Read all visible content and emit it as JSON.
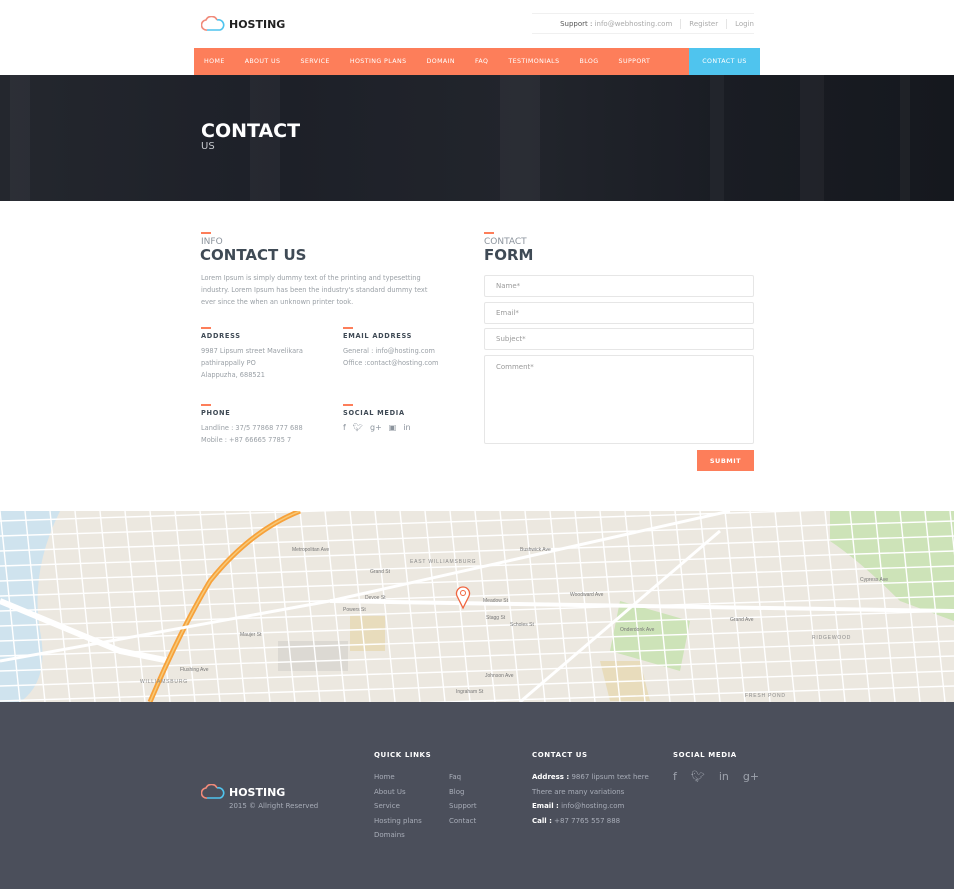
{
  "header": {
    "logo": "HOSTING",
    "support_label": "Support :",
    "support_email": "info@webhosting.com",
    "register": "Register",
    "login": "Login"
  },
  "nav": [
    "HOME",
    "ABOUT US",
    "SERVICE",
    "HOSTING PLANS",
    "DOMAIN",
    "FAQ",
    "TESTIMONIALS",
    "BLOG",
    "SUPPORT",
    "CONTACT US"
  ],
  "nav_active": "CONTACT US",
  "colors": {
    "accent": "#fd7e5a",
    "active": "#4fc4ee",
    "footer": "#4b4f5b",
    "heading": "#3f4a55"
  },
  "hero": {
    "title": "CONTACT",
    "subtitle": "US"
  },
  "info": {
    "kicker": "INFO",
    "title": "CONTACT US",
    "text": "Lorem Ipsum is simply dummy text of the printing and typesetting industry. Lorem Ipsum has been the industry's standard dummy text ever since the when an unknown printer took.",
    "address": {
      "label": "ADDRESS",
      "lines": [
        "9987 Lipsum street Mavelikara",
        "pathirappally PO",
        "Alappuzha, 688521"
      ]
    },
    "email": {
      "label": "EMAIL ADDRESS",
      "lines": [
        "General : info@hosting.com",
        "Office :contact@hosting.com"
      ]
    },
    "phone": {
      "label": "PHONE",
      "lines": [
        "Landline : 37/5 77868 777 688",
        "Mobile : +87 66665 7785 7"
      ]
    },
    "social": {
      "label": "SOCIAL MEDIA",
      "icons": [
        "facebook-icon",
        "twitter-icon",
        "google-plus-icon",
        "youtube-icon",
        "linkedin-icon"
      ]
    }
  },
  "form": {
    "kicker": "CONTACT",
    "title": "FORM",
    "name_ph": "Name*",
    "email_ph": "Email*",
    "subject_ph": "Subject*",
    "comment_ph": "Comment*",
    "submit": "SUBMIT"
  },
  "map": {
    "labels": [
      "EAST WILLIAMSBURG",
      "WILLIAMSBURG",
      "RIDGEWOOD",
      "FRESH POND",
      "Meadow St",
      "Stagg St",
      "Scholes St",
      "Johnson Ave",
      "Ingraham St",
      "Maujer St",
      "Grand St",
      "Flushing Ave",
      "Woodward Ave",
      "Devoe St",
      "Powers St",
      "Metropolitan Ave",
      "Grand Ave",
      "Bushwick Ave",
      "Onderdonk Ave",
      "Cypress Ave"
    ]
  },
  "footer": {
    "logo": "HOSTING",
    "copyright": "2015 © Allright Reserved",
    "quick_title": "QUICK LINKS",
    "links_col1": [
      "Home",
      "About Us",
      "Service",
      "Hosting plans",
      "Domains"
    ],
    "links_col2": [
      "Faq",
      "Blog",
      "Support",
      "Contact"
    ],
    "contact_title": "CONTACT US",
    "address_label": "Address :",
    "address": "9867 lipsum text here",
    "address2": "There are many variations",
    "email_label": "Email :",
    "email": "info@hosting.com",
    "call_label": "Call :",
    "call": "+87 7765 557 888",
    "social_title": "SOCIAL MEDIA"
  }
}
